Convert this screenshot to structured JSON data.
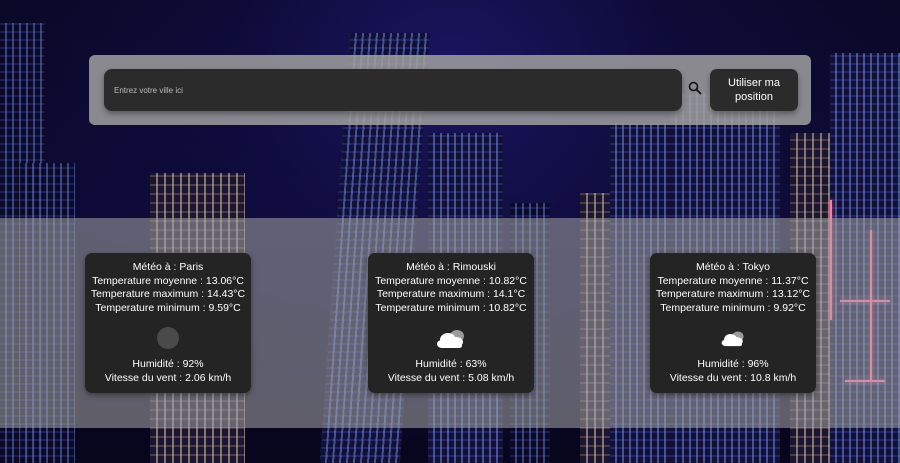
{
  "search": {
    "placeholder": "Entrez votre ville ici",
    "search_icon": "search-icon",
    "position_label": "Utiliser ma position"
  },
  "cards": [
    {
      "city_line": "Météo à : Paris",
      "avg_line": "Temperature moyenne : 13.06°C",
      "max_line": "Temperature maximum : 14.43°C",
      "min_line": "Temperature minimum : 9.59°C",
      "icon": "weather-placeholder-icon",
      "humidity_line": "Humidité : 92%",
      "wind_line": "Vitesse du vent : 2.06 km/h"
    },
    {
      "city_line": "Météo à : Rimouski",
      "avg_line": "Temperature moyenne : 10.82°C",
      "max_line": "Temperature maximum : 14.1°C",
      "min_line": "Temperature minimum : 10.82°C",
      "icon": "cloudy-icon",
      "humidity_line": "Humidité : 63%",
      "wind_line": "Vitesse du vent : 5.08 km/h"
    },
    {
      "city_line": "Météo à : Tokyo",
      "avg_line": "Temperature moyenne : 11.37°C",
      "max_line": "Temperature maximum : 13.12°C",
      "min_line": "Temperature minimum : 9.92°C",
      "icon": "cloudy-icon",
      "humidity_line": "Humidité : 96%",
      "wind_line": "Vitesse du vent : 10.8 km/h"
    }
  ]
}
